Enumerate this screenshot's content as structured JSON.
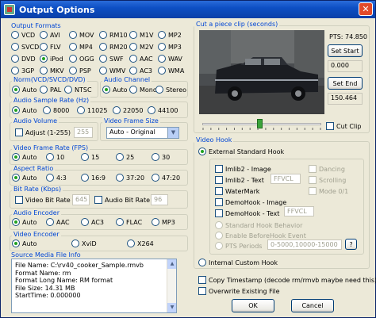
{
  "window": {
    "title": "Output Options"
  },
  "formats": {
    "label": "Output Formats",
    "options": [
      {
        "label": "VCD",
        "on": false
      },
      {
        "label": "AVI",
        "on": false
      },
      {
        "label": "MOV",
        "on": false
      },
      {
        "label": "RM10",
        "on": false
      },
      {
        "label": "M1V",
        "on": false
      },
      {
        "label": "MP2",
        "on": false
      },
      {
        "label": "SVCD",
        "on": false
      },
      {
        "label": "FLV",
        "on": false
      },
      {
        "label": "MP4",
        "on": false
      },
      {
        "label": "RM20",
        "on": false
      },
      {
        "label": "M2V",
        "on": false
      },
      {
        "label": "MP3",
        "on": false
      },
      {
        "label": "DVD",
        "on": false
      },
      {
        "label": "iPod",
        "on": true
      },
      {
        "label": "OGG",
        "on": false
      },
      {
        "label": "SWF",
        "on": false
      },
      {
        "label": "AAC",
        "on": false
      },
      {
        "label": "WAV",
        "on": false
      },
      {
        "label": "3GP",
        "on": false
      },
      {
        "label": "MKV",
        "on": false
      },
      {
        "label": "PSP",
        "on": false
      },
      {
        "label": "WMV",
        "on": false
      },
      {
        "label": "AC3",
        "on": false
      },
      {
        "label": "WMA",
        "on": false
      }
    ]
  },
  "norm": {
    "label": "Norm(VCD/SVCD/DVD)",
    "options": [
      {
        "label": "Auto",
        "on": true
      },
      {
        "label": "PAL",
        "on": false
      },
      {
        "label": "NTSC",
        "on": false
      }
    ]
  },
  "channel": {
    "label": "Audio Channel",
    "options": [
      {
        "label": "Auto",
        "on": true
      },
      {
        "label": "Mono",
        "on": false
      },
      {
        "label": "Stereo",
        "on": false
      }
    ]
  },
  "samplerate": {
    "label": "Audio Sample Rate (Hz)",
    "options": [
      {
        "label": "Auto",
        "on": true
      },
      {
        "label": "8000",
        "on": false
      },
      {
        "label": "11025",
        "on": false
      },
      {
        "label": "22050",
        "on": false
      },
      {
        "label": "44100",
        "on": false
      }
    ]
  },
  "volume": {
    "label": "Audio Volume",
    "adjust_label": "Adjust (1-255)",
    "value": "255"
  },
  "framesize": {
    "label": "Video Frame Size",
    "selected": "Auto - Original"
  },
  "framerate": {
    "label": "Video Frame Rate (FPS)",
    "options": [
      {
        "label": "Auto",
        "on": true
      },
      {
        "label": "10",
        "on": false
      },
      {
        "label": "15",
        "on": false
      },
      {
        "label": "25",
        "on": false
      },
      {
        "label": "30",
        "on": false
      }
    ]
  },
  "aspect": {
    "label": "Aspect Ratio",
    "options": [
      {
        "label": "Auto",
        "on": true
      },
      {
        "label": "4:3",
        "on": false
      },
      {
        "label": "16:9",
        "on": false
      },
      {
        "label": "37:20",
        "on": false
      },
      {
        "label": "47:20",
        "on": false
      }
    ]
  },
  "bitrate": {
    "label": "Bit Rate (Kbps)",
    "video_label": "Video Bit Rate",
    "video_value": "645",
    "audio_label": "Audio Bit Rate",
    "audio_value": "96"
  },
  "aencoder": {
    "label": "Audio Encoder",
    "options": [
      {
        "label": "Auto",
        "on": true
      },
      {
        "label": "AAC",
        "on": false
      },
      {
        "label": "AC3",
        "on": false
      },
      {
        "label": "FLAC",
        "on": false
      },
      {
        "label": "MP3",
        "on": false
      }
    ]
  },
  "vencoder": {
    "label": "Video Encoder",
    "options": [
      {
        "label": "Auto",
        "on": true
      },
      {
        "label": "XviD",
        "on": false
      },
      {
        "label": "X264",
        "on": false
      }
    ]
  },
  "sourceinfo": {
    "label": "Source Media File Info",
    "lines": [
      "File Name: C:\\rv40_cooker_Sample.rmvb",
      "Format Name: rm",
      "Format Long Name: RM format",
      "File Size: 14.31 MB",
      "StartTime: 0.000000"
    ]
  },
  "clip": {
    "label": "Cut a piece clip (seconds)",
    "pts": "PTS: 74.850",
    "set_start": "Set Start",
    "start_value": "0.000",
    "set_end": "Set End",
    "end_value": "150.464",
    "cut_label": "Cut Clip",
    "slider_position": 0.48
  },
  "hook": {
    "label": "Video Hook",
    "external_label": "External Standard Hook",
    "imlib_image": "Imlib2 - Image",
    "imlib_text": "Imlib2 - Text",
    "imlib_text_value": "FFVCL",
    "watermark": "WaterMark",
    "demo_image": "DemoHook - Image",
    "demo_text": "DemoHook - Text",
    "demo_text_value": "FFVCL",
    "dancing": "Dancing",
    "scrolling": "Scrolling",
    "mode": "Mode 0/1",
    "std_behavior": "Standard Hook Behavior",
    "enable_before": "Enable BeforeHook Event",
    "pts_periods": "PTS Periods",
    "pts_value": "0-5000,10000-15000",
    "help": "?",
    "internal_label": "Internal Custom Hook"
  },
  "copy_timestamp": "Copy Timestamp (decode rm/rmvb maybe need this)",
  "overwrite": "Overwrite Existing File",
  "ok": "OK",
  "cancel": "Cancel"
}
